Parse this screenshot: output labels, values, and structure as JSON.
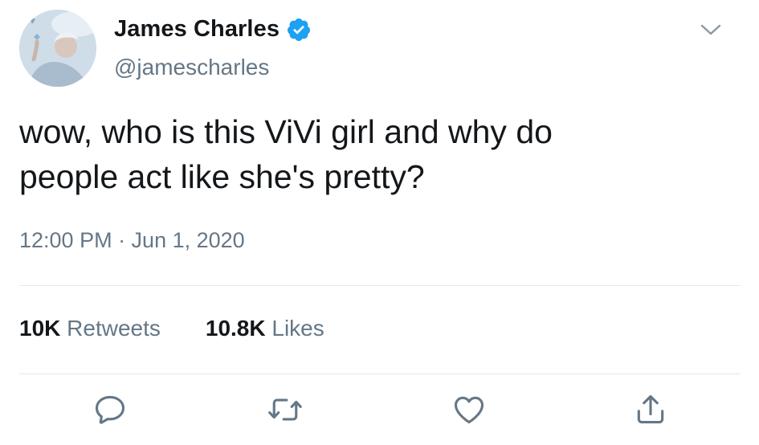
{
  "user": {
    "display_name": "James Charles",
    "handle": "@jamescharles",
    "verified": true
  },
  "tweet": {
    "text": "wow, who is this ViVi girl and why do\npeople act like she's pretty?",
    "timestamp": "12:00 PM · Jun 1, 2020"
  },
  "stats": {
    "retweets_count": "10K",
    "retweets_label": "Retweets",
    "likes_count": "10.8K",
    "likes_label": "Likes"
  },
  "icons": {
    "verified": "verified-badge-icon",
    "menu": "chevron-down-icon",
    "reply": "reply-icon",
    "retweet": "retweet-icon",
    "like": "heart-icon",
    "share": "share-icon"
  },
  "colors": {
    "verified": "#1da1f2",
    "secondary_text": "#657786",
    "primary_text": "#14171a",
    "divider": "#e1e8ed"
  }
}
